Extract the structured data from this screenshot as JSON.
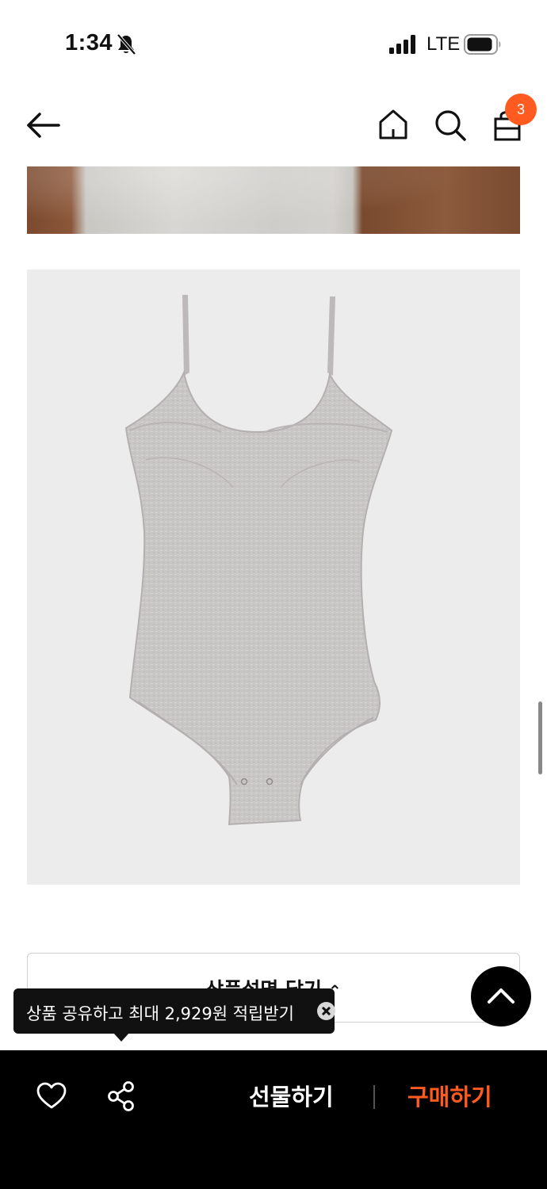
{
  "status_bar": {
    "time": "1:34",
    "network": "LTE",
    "icons": [
      "bell-slash-icon",
      "signal-icon",
      "battery-icon"
    ]
  },
  "header": {
    "icons": [
      "arrow-left-icon",
      "home-icon",
      "search-icon",
      "shopping-bag-icon"
    ],
    "cart_count": "3"
  },
  "product": {
    "collapse_label": "상품설명 닫기"
  },
  "tooltip": {
    "text": "상품 공유하고 최대 2,929원 적립받기"
  },
  "bottom_bar": {
    "gift_label": "선물하기",
    "buy_label": "구매하기",
    "icons": [
      "heart-icon",
      "share-icon"
    ]
  },
  "colors": {
    "accent": "#ff5a1f",
    "bar_background": "#000000",
    "image_background": "#ececed"
  }
}
